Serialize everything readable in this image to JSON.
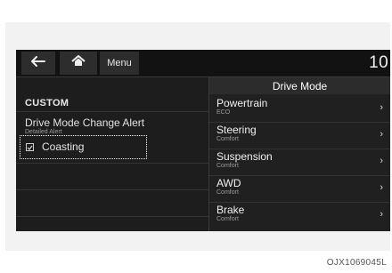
{
  "topbar": {
    "menu_label": "Menu",
    "time_text": "10:"
  },
  "right_header": "Drive Mode",
  "left_pane": {
    "title": "CUSTOM",
    "alert_label": "Drive Mode Change Alert",
    "alert_sub": "Detailed Alert",
    "coasting_label": "Coasting"
  },
  "modes": [
    {
      "name": "Powertrain",
      "value": "ECO"
    },
    {
      "name": "Steering",
      "value": "Comfort"
    },
    {
      "name": "Suspension",
      "value": "Comfort"
    },
    {
      "name": "AWD",
      "value": "Comfort"
    },
    {
      "name": "Brake",
      "value": "Comfort"
    }
  ],
  "caption": "OJX1069045L",
  "colors": {
    "screen_bg": "#1b1b1b",
    "panel_bg": "#f2f2f2"
  }
}
